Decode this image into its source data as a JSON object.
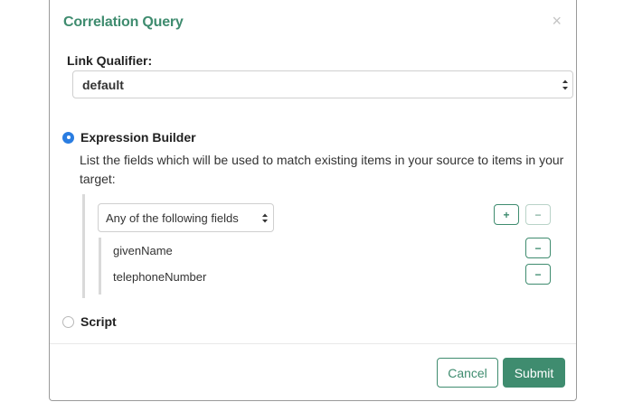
{
  "modal": {
    "title": "Correlation Query",
    "close_glyph": "×"
  },
  "link_qualifier": {
    "label": "Link Qualifier:",
    "value": "default"
  },
  "mode": {
    "selected": "expression_builder",
    "expression_builder_label": "Expression Builder",
    "script_label": "Script"
  },
  "expression": {
    "description": "List the fields which will be used to match existing items in your source to items in your target:",
    "operator_value": "Any of the following fields",
    "add_label": "+",
    "remove_label": "−",
    "fields": [
      {
        "name": "givenName",
        "remove_label": "−"
      },
      {
        "name": "telephoneNumber",
        "remove_label": "−"
      }
    ]
  },
  "footer": {
    "cancel_label": "Cancel",
    "submit_label": "Submit"
  },
  "colors": {
    "accent": "#3f8c6f",
    "radio_selected": "#2a7de1"
  }
}
